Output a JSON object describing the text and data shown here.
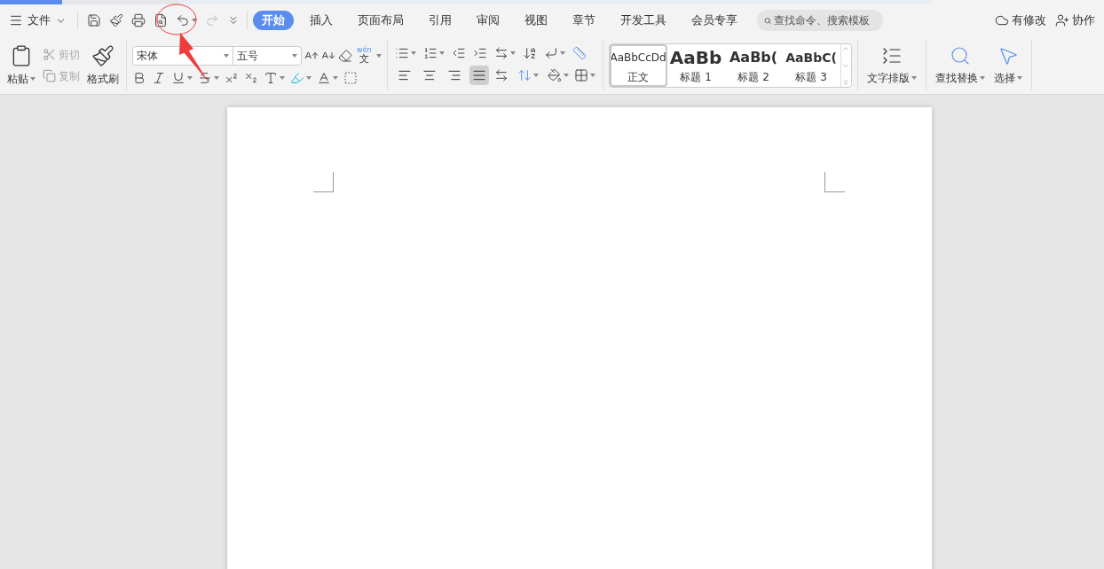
{
  "menu_bar": {
    "file_menu": "文件",
    "undo_disabled": false,
    "redo_disabled": true,
    "tabs": [
      {
        "label": "开始",
        "selected": true
      },
      {
        "label": "插入",
        "selected": false
      },
      {
        "label": "页面布局",
        "selected": false
      },
      {
        "label": "引用",
        "selected": false
      },
      {
        "label": "审阅",
        "selected": false
      },
      {
        "label": "视图",
        "selected": false
      },
      {
        "label": "章节",
        "selected": false
      },
      {
        "label": "开发工具",
        "selected": false
      },
      {
        "label": "会员专享",
        "selected": false
      }
    ],
    "search": {
      "placeholder": "查找命令、搜索模板"
    },
    "status": "有修改",
    "collaborate": "协作"
  },
  "ribbon": {
    "clipboard": {
      "paste": "粘贴",
      "cut": {
        "label": "剪切",
        "disabled": true
      },
      "copy": {
        "label": "复制",
        "disabled": true
      },
      "format_painter": "格式刷"
    },
    "font": {
      "name": "宋体",
      "size": "五号",
      "phonetic_ruby": "wén",
      "phonetic_char": "文"
    },
    "alignment": [
      {
        "selected": false
      },
      {
        "selected": false
      },
      {
        "selected": false
      },
      {
        "selected": true
      }
    ],
    "styles": [
      {
        "preview": "AaBbCcDd",
        "label": "正文",
        "selected": true,
        "kind": "normal"
      },
      {
        "preview": "AaBb",
        "label": "标题 1",
        "selected": false,
        "kind": "heading1"
      },
      {
        "preview": "AaBb(",
        "label": "标题 2",
        "selected": false,
        "kind": "heading2"
      },
      {
        "preview": "AaBbC(",
        "label": "标题 3",
        "selected": false,
        "kind": "heading3"
      }
    ],
    "text_layout": "文字排版",
    "find_replace": "查找替换",
    "select": "选择"
  }
}
